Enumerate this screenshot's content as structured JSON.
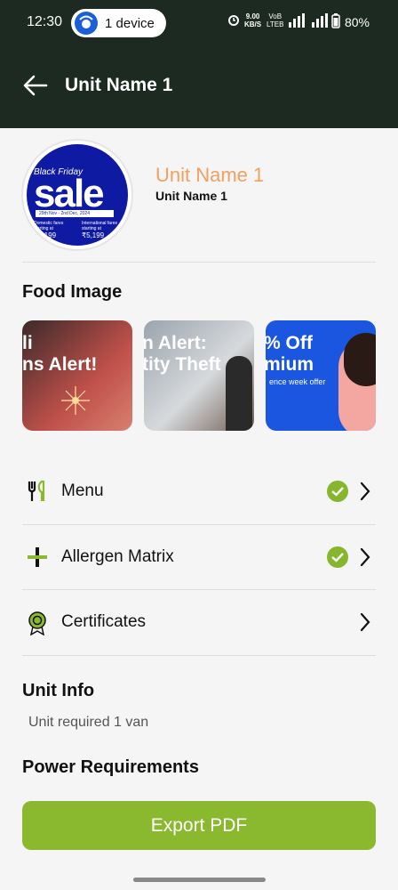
{
  "status_bar": {
    "time": "12:30",
    "device_pill": "1 device",
    "net_speed_top": "9.00",
    "net_speed_bottom": "KB/S",
    "net_type_top": "VoB",
    "net_type_bottom": "LTEB",
    "battery": "80%"
  },
  "app_bar": {
    "title": "Unit Name 1"
  },
  "profile": {
    "name_primary": "Unit Name 1",
    "name_secondary": "Unit Name 1",
    "avatar": {
      "tagline": "Black Friday",
      "headline": "sale",
      "dates": "29th Nov - 2nd Dec, 2024",
      "left_text": "Domestic fares starting at",
      "left_price": "₹1,199",
      "right_text": "International fares starting at",
      "right_price": "₹5,199"
    }
  },
  "food_image": {
    "title": "Food Image",
    "thumbnails": [
      {
        "text": "li\nns Alert!",
        "sub": ""
      },
      {
        "text": "n Alert:\ntity Theft",
        "sub": ""
      },
      {
        "text": "% Off\nmium",
        "sub": "ence week offer"
      }
    ]
  },
  "menu_items": [
    {
      "label": "Menu",
      "icon": "cutlery-icon",
      "checked": true
    },
    {
      "label": "Allergen Matrix",
      "icon": "plus-cross-icon",
      "checked": true
    },
    {
      "label": "Certificates",
      "icon": "badge-icon",
      "checked": false
    }
  ],
  "unit_info": {
    "title": "Unit Info",
    "text": "Unit required 1 van"
  },
  "power": {
    "title": "Power Requirements"
  },
  "export": {
    "label": "Export PDF"
  },
  "colors": {
    "header_bg": "#1c2a22",
    "accent_green": "#8ab82e",
    "name_orange": "#f0a060"
  }
}
